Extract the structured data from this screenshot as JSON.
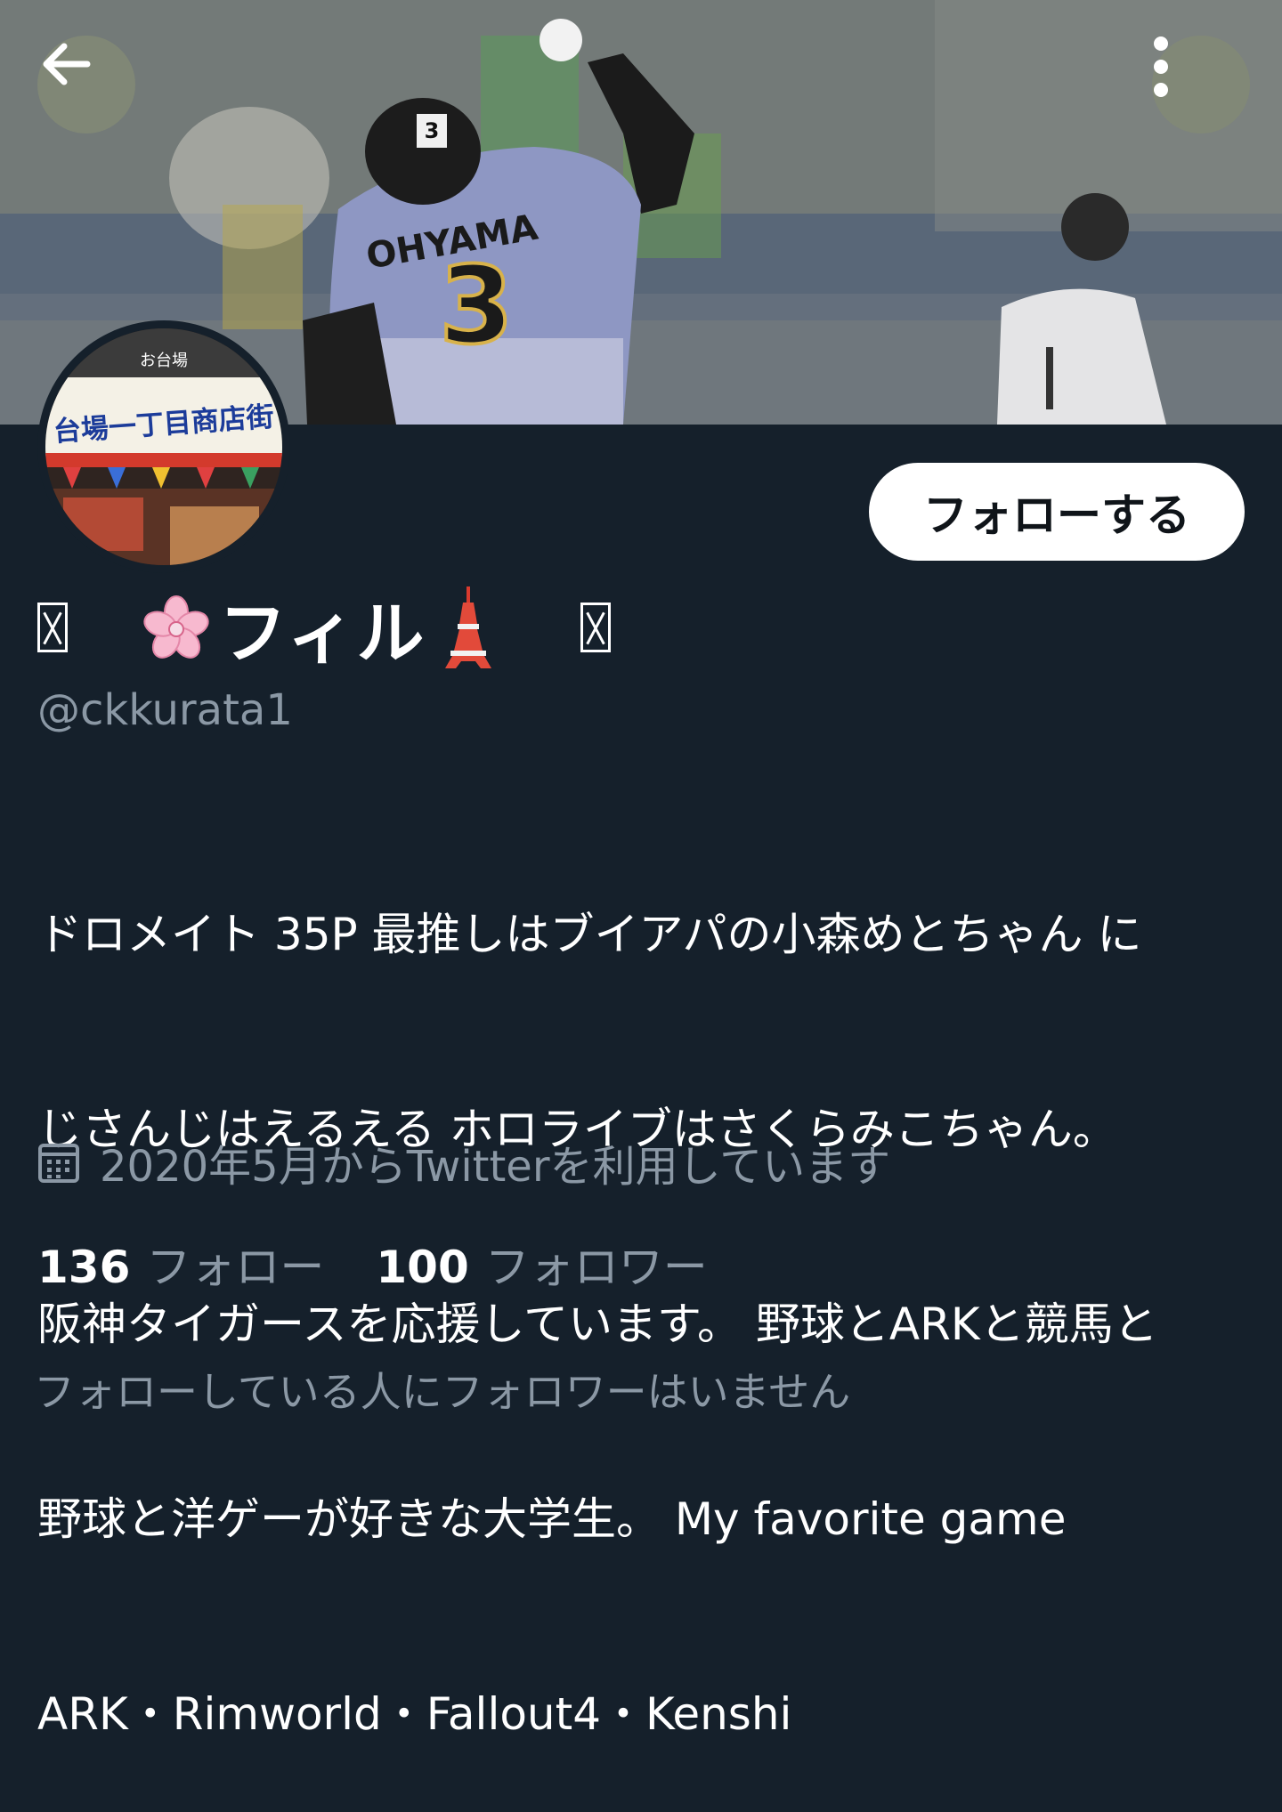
{
  "header": {
    "back_icon": "arrow-left-icon",
    "more_icon": "vertical-ellipsis-icon"
  },
  "banner": {
    "jersey_name": "OHYAMA",
    "jersey_number": "3",
    "helmet_number": "3",
    "background_player_number": "1"
  },
  "avatar": {
    "sign_text": "台場一丁目商店街",
    "sign_subtext": "お台場"
  },
  "follow_button": {
    "label": "フォローする"
  },
  "profile": {
    "name_prefix_glyph": "missing-glyph",
    "name_emoji_before": "🌸",
    "display_name": "フィル",
    "name_emoji_after": "🗼",
    "name_suffix_glyph": "missing-glyph",
    "handle": "@ckkurata1",
    "bio_lines": [
      "ドロメイト 35P 最推しはブイアパの小森めとちゃん に",
      "じさんじはえるえる ホロライブはさくらみこちゃん。",
      "阪神タイガースを応援しています。 野球とARKと競馬と",
      "野球と洋ゲーが好きな大学生。 My favorite game",
      "ARK・Rimworld・Fallout4・Kenshi"
    ],
    "joined_icon": "calendar-icon",
    "joined": "2020年5月からTwitterを利用しています"
  },
  "stats": {
    "following_count": "136",
    "following_label": "フォロー",
    "followers_count": "100",
    "followers_label": "フォロワー"
  },
  "mutual_note": "フォローしている人にフォロワーはいません",
  "colors": {
    "background": "#15202b",
    "secondary_text": "#8b98a5",
    "button_bg": "#ffffff",
    "button_text": "#0f1419"
  }
}
